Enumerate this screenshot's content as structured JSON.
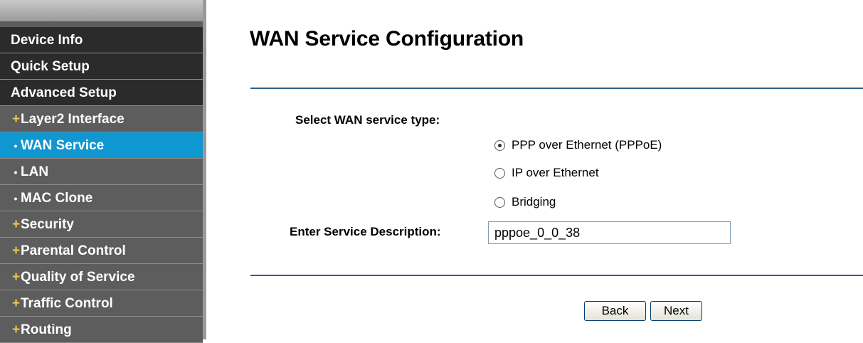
{
  "sidebar": {
    "items": [
      {
        "label": "Device Info",
        "type": "top",
        "bullet": ""
      },
      {
        "label": "Quick Setup",
        "type": "top",
        "bullet": ""
      },
      {
        "label": "Advanced Setup",
        "type": "top",
        "bullet": ""
      },
      {
        "label": "Layer2 Interface",
        "type": "sub",
        "bullet": "+"
      },
      {
        "label": "WAN Service",
        "type": "sub",
        "bullet": "•",
        "active": true
      },
      {
        "label": "LAN",
        "type": "sub",
        "bullet": "•"
      },
      {
        "label": "MAC Clone",
        "type": "sub",
        "bullet": "•"
      },
      {
        "label": "Security",
        "type": "sub",
        "bullet": "+"
      },
      {
        "label": "Parental Control",
        "type": "sub",
        "bullet": "+"
      },
      {
        "label": "Quality of Service",
        "type": "sub",
        "bullet": "+"
      },
      {
        "label": "Traffic Control",
        "type": "sub",
        "bullet": "+"
      },
      {
        "label": "Routing",
        "type": "sub",
        "bullet": "+"
      }
    ]
  },
  "main": {
    "title": "WAN Service Configuration",
    "service_type_label": "Select WAN service type:",
    "service_options": [
      {
        "label": "PPP over Ethernet (PPPoE)",
        "selected": true
      },
      {
        "label": "IP over Ethernet",
        "selected": false
      },
      {
        "label": "Bridging",
        "selected": false
      }
    ],
    "description_label": "Enter Service Description:",
    "description_value": "pppoe_0_0_38",
    "back_label": "Back",
    "next_label": "Next"
  },
  "colors": {
    "sidebar_top_item": "#2b2b2b",
    "sidebar_sub_item": "#5d5d5d",
    "sidebar_active": "#0f97d1",
    "plus_bullet": "#f4c34c",
    "rule": "#2f5f86"
  }
}
